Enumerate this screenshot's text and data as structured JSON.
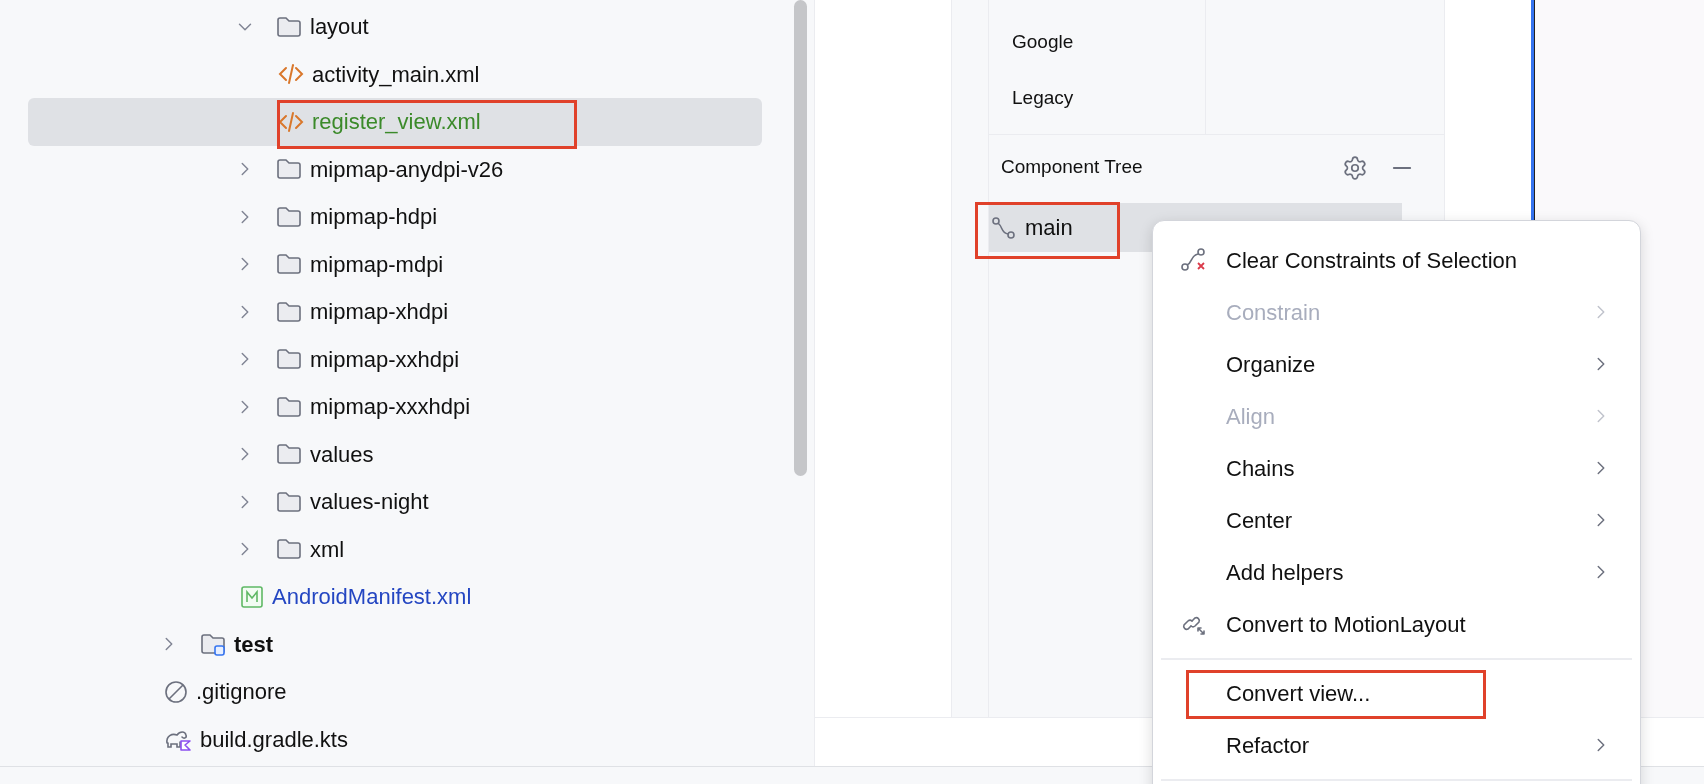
{
  "project_tree": [
    {
      "children": [
        {
          "children": [
            {
              "label": "layout",
              "kind": "folder",
              "expanded": true,
              "selected": false,
              "children": [
                {
                  "label": "activity_main.xml",
                  "kind": "layout_file",
                  "color": "#111111",
                  "selected": false,
                  "marked": false
                },
                {
                  "label": "register_view.xml",
                  "kind": "layout_file",
                  "color": "#3b8a2a",
                  "selected": true,
                  "marked": true
                }
              ]
            },
            {
              "label": "mipmap-anydpi-v26",
              "kind": "folder",
              "expanded": false,
              "selected": false
            },
            {
              "label": "mipmap-hdpi",
              "kind": "folder",
              "expanded": false,
              "selected": false
            },
            {
              "label": "mipmap-mdpi",
              "kind": "folder",
              "expanded": false,
              "selected": false
            },
            {
              "label": "mipmap-xhdpi",
              "kind": "folder",
              "expanded": false,
              "selected": false
            },
            {
              "label": "mipmap-xxhdpi",
              "kind": "folder",
              "expanded": false,
              "selected": false
            },
            {
              "label": "mipmap-xxxhdpi",
              "kind": "folder",
              "expanded": false,
              "selected": false
            },
            {
              "label": "values",
              "kind": "folder",
              "expanded": false,
              "selected": false
            },
            {
              "label": "values-night",
              "kind": "folder",
              "expanded": false,
              "selected": false
            },
            {
              "label": "xml",
              "kind": "folder",
              "expanded": false,
              "selected": false
            },
            {
              "label": "AndroidManifest.xml",
              "kind": "manifest_file",
              "color": "#2446c2",
              "selected": false,
              "marked": false
            }
          ]
        }
      ]
    },
    {
      "label": "test",
      "kind": "test_folder",
      "expanded": false,
      "selected": false
    },
    {
      "label": ".gitignore",
      "kind": "ignore_file",
      "color": "#111111",
      "selected": false,
      "marked": false
    },
    {
      "label": "build.gradle.kts",
      "kind": "gradle_file",
      "color": "#111111",
      "selected": false,
      "marked": false
    }
  ],
  "palette": {
    "categories": [
      {
        "label": "Google"
      },
      {
        "label": "Legacy"
      }
    ]
  },
  "component_tree": {
    "title": "Component Tree",
    "nodes": [
      {
        "label": "main",
        "selected": true,
        "marked": true
      }
    ]
  },
  "context_menu": [
    {
      "kind": "clear_constraints",
      "label": "Clear Constraints of Selection",
      "disabled": false,
      "submenu": false,
      "marked": false
    },
    {
      "kind": "plain",
      "label": "Constrain",
      "disabled": true,
      "submenu": true,
      "marked": false
    },
    {
      "kind": "plain",
      "label": "Organize",
      "disabled": false,
      "submenu": true,
      "marked": false
    },
    {
      "kind": "plain",
      "label": "Align",
      "disabled": true,
      "submenu": true,
      "marked": false
    },
    {
      "kind": "plain",
      "label": "Chains",
      "disabled": false,
      "submenu": true,
      "marked": false
    },
    {
      "kind": "plain",
      "label": "Center",
      "disabled": false,
      "submenu": true,
      "marked": false
    },
    {
      "kind": "plain",
      "label": "Add helpers",
      "disabled": false,
      "submenu": true,
      "marked": false
    },
    {
      "kind": "motion",
      "label": "Convert to MotionLayout",
      "disabled": false,
      "submenu": false,
      "marked": false
    },
    {
      "kind": "separator"
    },
    {
      "kind": "plain",
      "label": "Convert view...",
      "disabled": false,
      "submenu": false,
      "marked": true
    },
    {
      "kind": "plain",
      "label": "Refactor",
      "disabled": false,
      "submenu": true,
      "marked": false
    },
    {
      "kind": "separator"
    }
  ]
}
